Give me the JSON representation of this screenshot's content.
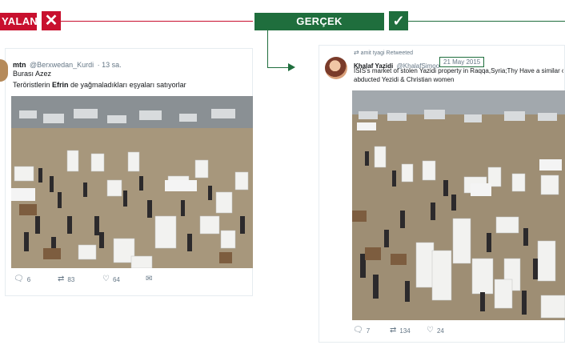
{
  "verdict": {
    "false_label": "YALAN",
    "false_icon": "x-icon",
    "true_label": "GERÇEK",
    "true_icon": "check-icon",
    "false_color": "#c8102e",
    "true_color": "#1f6e3d"
  },
  "tweet_left": {
    "name": "mtn",
    "handle": "@Berxwedan_Kurdi",
    "time": "· 13 sa.",
    "line1": "Burası Azez",
    "line2_pre": "Teröristlerin ",
    "line2_bold": "Efrin",
    "line2_post": " de yağmaladıkları eşyaları satıyorlar",
    "replies": "6",
    "retweets": "83",
    "likes": "64"
  },
  "tweet_right": {
    "retweeted_by": "amit tyagi Retweeted",
    "name": "Khalaf Yazidi",
    "handle": "@KhalafSimoo",
    "date": "21 May 2015",
    "text_line1": "ISIS's market of stolen Yazidi property in Raqqa,Syria;Thy Have a similar on",
    "text_line2": "abducted Yezidi & Christian women",
    "replies": "7",
    "retweets": "134",
    "likes": "24"
  }
}
